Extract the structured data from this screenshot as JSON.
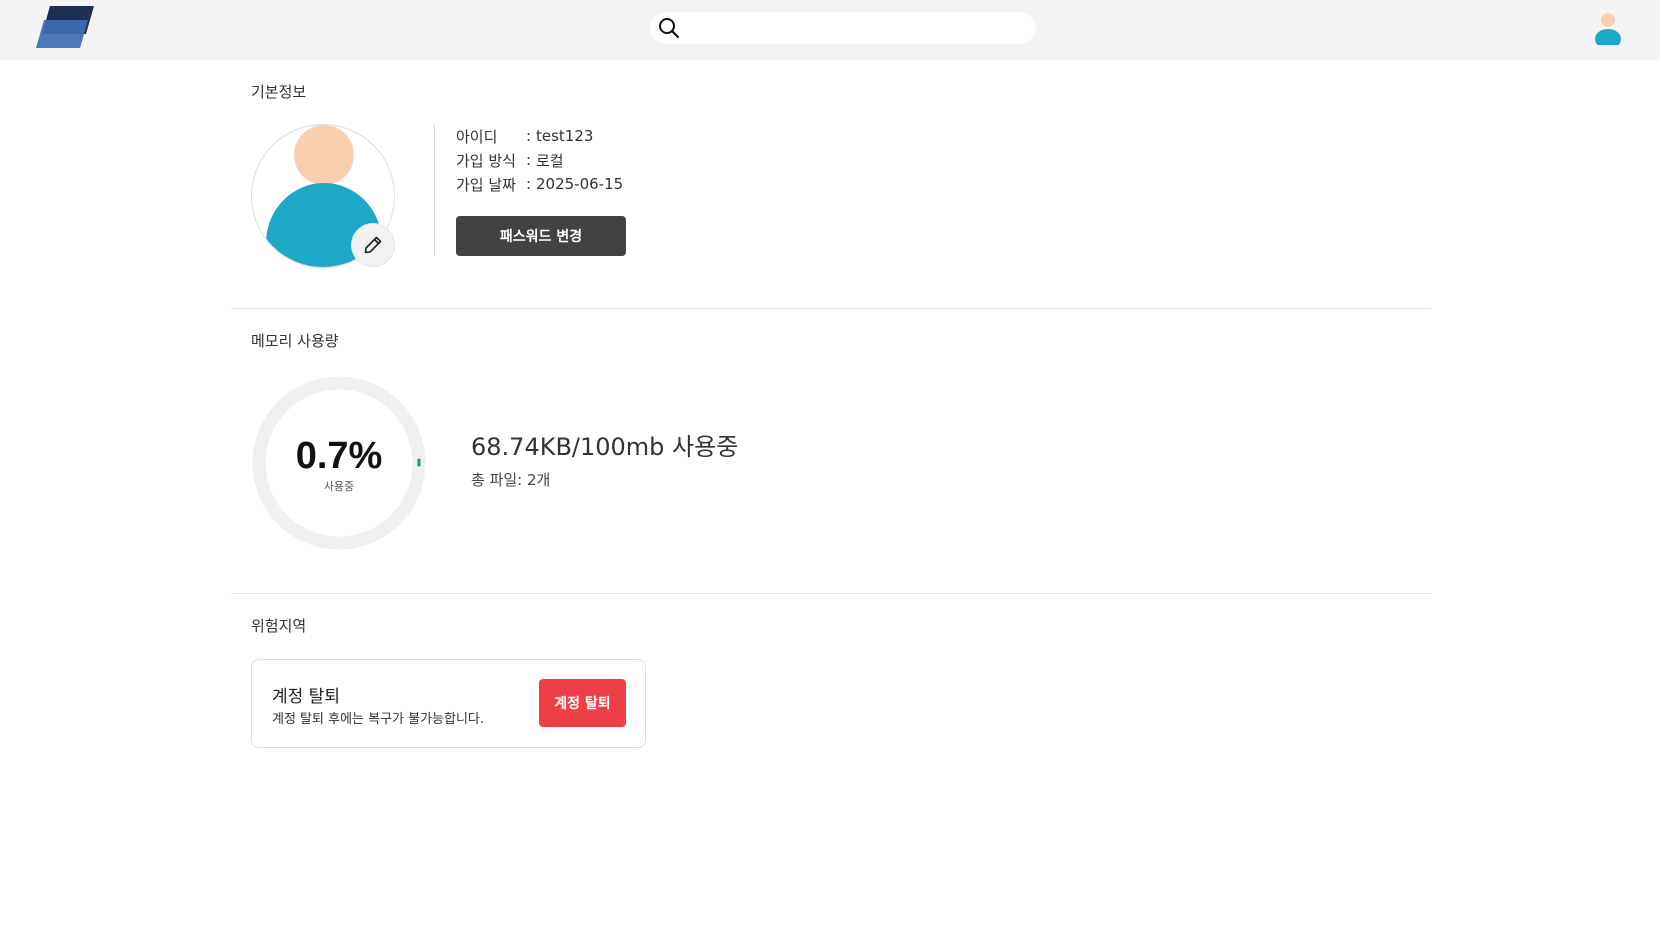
{
  "header": {
    "logo_icon": "app-logo-icon",
    "search": {
      "placeholder": "",
      "value": "",
      "icon": "search-icon"
    },
    "avatar_icon": "user-avatar-icon"
  },
  "basic_info": {
    "title": "기본정보",
    "avatar_icon": "user-avatar-icon",
    "edit_icon": "pencil-icon",
    "fields": [
      {
        "label": "아이디",
        "sep": ":",
        "value": "test123"
      },
      {
        "label": "가입 방식",
        "sep": ":",
        "value": "로컬"
      },
      {
        "label": "가입 날짜",
        "sep": ":",
        "value": "2025-06-15"
      }
    ],
    "password_button": "패스워드 변경"
  },
  "memory": {
    "title": "메모리 사용량",
    "percent_text": "0.7%",
    "percent_value": 0.7,
    "percent_sub": "사용중",
    "usage_text": "68.74KB/100mb 사용중",
    "files_text": "총 파일: 2개"
  },
  "danger": {
    "title": "위험지역",
    "card_title": "계정 탈퇴",
    "card_desc": "계정 탈퇴 후에는 복구가 불가능합니다.",
    "button": "계정 탈퇴"
  },
  "colors": {
    "header_bg": "#f4f4f4",
    "primary_dark": "#424242",
    "danger": "#ef3f46",
    "gauge_track": "#f0f0f0",
    "gauge_fill": "#1a9a8c",
    "avatar_skin": "#f8d0b0",
    "avatar_body": "#1da8c8"
  }
}
